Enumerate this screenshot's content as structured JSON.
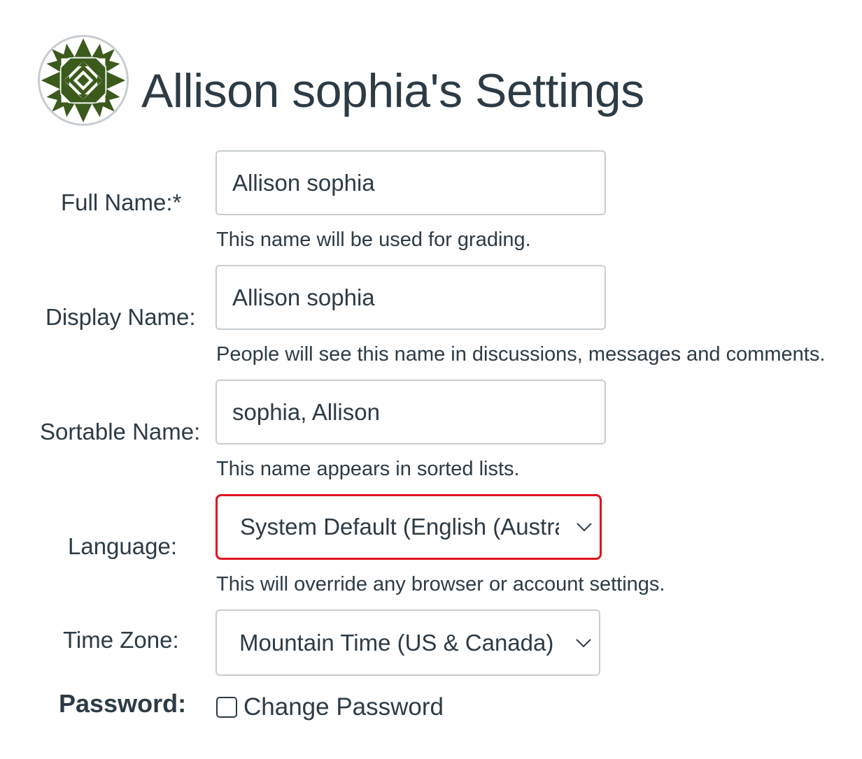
{
  "page": {
    "title": "Allison sophia's Settings"
  },
  "avatar": {
    "icon": "quilt-pattern-avatar",
    "colors": {
      "fill": "#3b5a1c",
      "background": "#ffffff",
      "border": "#c7cdd1"
    }
  },
  "form": {
    "full_name": {
      "label": "Full Name:*",
      "value": "Allison sophia",
      "hint": "This name will be used for grading."
    },
    "display_name": {
      "label": "Display Name:",
      "value": "Allison sophia",
      "hint": "People will see this name in discussions, messages and comments."
    },
    "sortable_name": {
      "label": "Sortable Name:",
      "value": "sophia, Allison",
      "hint": "This name appears in sorted lists."
    },
    "language": {
      "label": "Language:",
      "selected": "System Default (English (Australia))",
      "hint": "This will override any browser or account settings.",
      "highlight_color": "#e0141e"
    },
    "time_zone": {
      "label": "Time Zone:",
      "selected": "Mountain Time (US & Canada)"
    },
    "password": {
      "label": "Password:",
      "checkbox_label": "Change Password",
      "checked": false
    }
  },
  "colors": {
    "text": "#2d3b45",
    "input_border": "#c7cdd1"
  }
}
